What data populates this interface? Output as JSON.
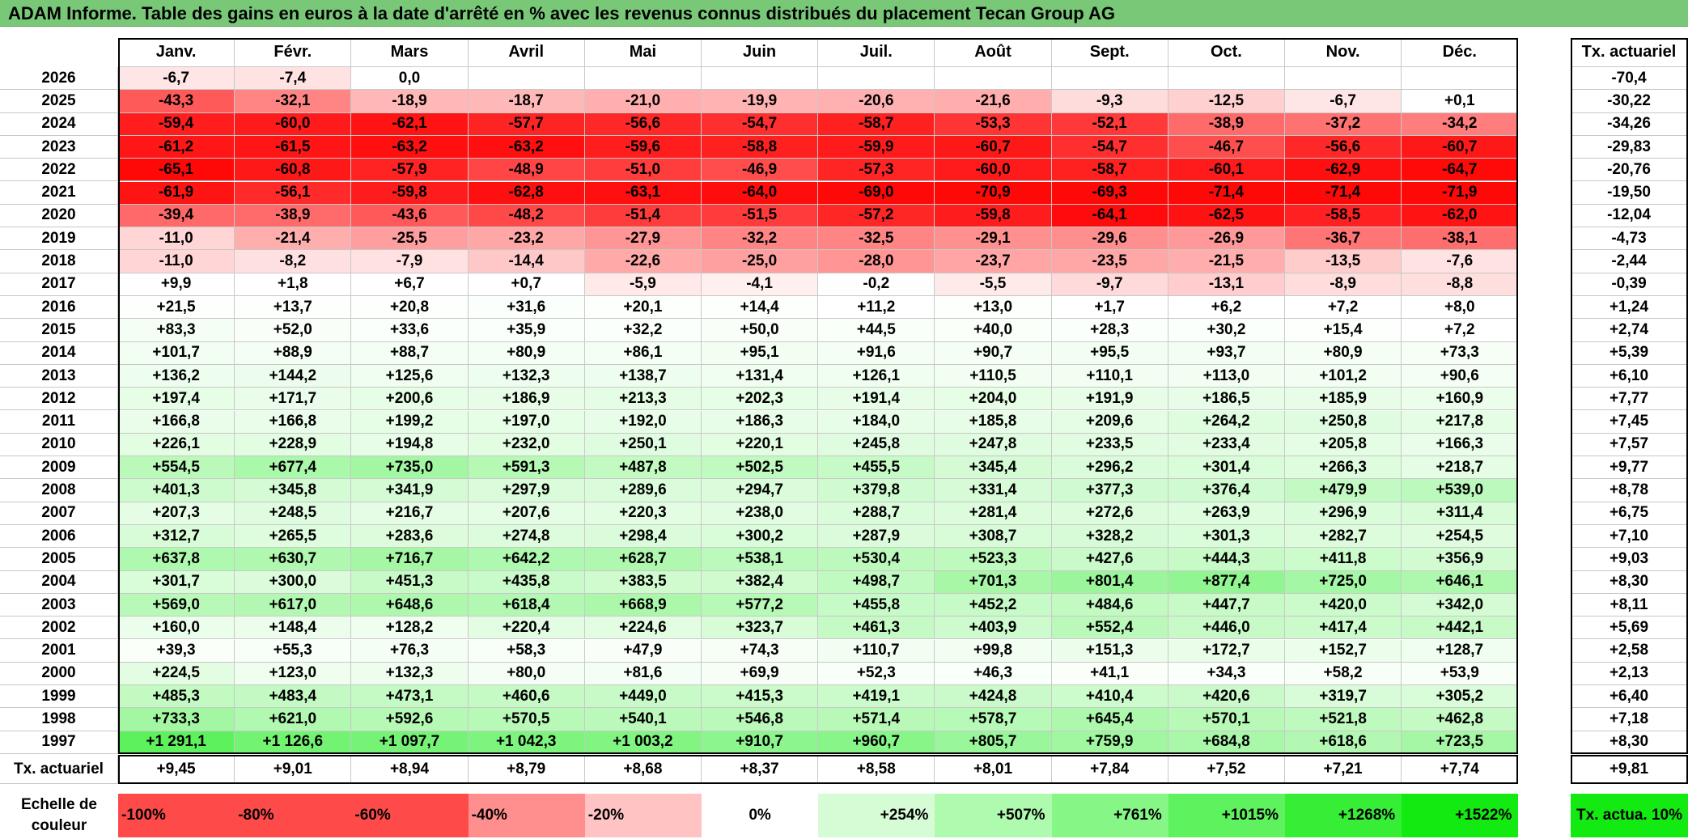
{
  "title": "ADAM Informe. Table des gains en euros à la date d'arrêté en % avec les revenus connus distribués du placement Tecan Group AG",
  "headers": {
    "months": [
      "Janv.",
      "Févr.",
      "Mars",
      "Avril",
      "Mai",
      "Juin",
      "Juil.",
      "Août",
      "Sept.",
      "Oct.",
      "Nov.",
      "Déc."
    ],
    "rate": "Tx. actuariel"
  },
  "chart_data": {
    "type": "table",
    "title": "ADAM Informe. Table des gains en euros à la date d'arrêté en % avec les revenus connus distribués du placement Tecan Group AG",
    "columns": [
      "Janv.",
      "Févr.",
      "Mars",
      "Avril",
      "Mai",
      "Juin",
      "Juil.",
      "Août",
      "Sept.",
      "Oct.",
      "Nov.",
      "Déc.",
      "Tx. actuariel"
    ],
    "rows": [
      {
        "year": "2026",
        "values": [
          "-6,7",
          "-7,4",
          "0,0",
          "",
          "",
          "",
          "",
          "",
          "",
          "",
          "",
          ""
        ],
        "rate": "-70,4"
      },
      {
        "year": "2025",
        "values": [
          "-43,3",
          "-32,1",
          "-18,9",
          "-18,7",
          "-21,0",
          "-19,9",
          "-20,6",
          "-21,6",
          "-9,3",
          "-12,5",
          "-6,7",
          "+0,1"
        ],
        "rate": "-30,22"
      },
      {
        "year": "2024",
        "values": [
          "-59,4",
          "-60,0",
          "-62,1",
          "-57,7",
          "-56,6",
          "-54,7",
          "-58,7",
          "-53,3",
          "-52,1",
          "-38,9",
          "-37,2",
          "-34,2"
        ],
        "rate": "-34,26"
      },
      {
        "year": "2023",
        "values": [
          "-61,2",
          "-61,5",
          "-63,2",
          "-63,2",
          "-59,6",
          "-58,8",
          "-59,9",
          "-60,7",
          "-54,7",
          "-46,7",
          "-56,6",
          "-60,7"
        ],
        "rate": "-29,83"
      },
      {
        "year": "2022",
        "values": [
          "-65,1",
          "-60,8",
          "-57,9",
          "-48,9",
          "-51,0",
          "-46,9",
          "-57,3",
          "-60,0",
          "-58,7",
          "-60,1",
          "-62,9",
          "-64,7"
        ],
        "rate": "-20,76"
      },
      {
        "year": "2021",
        "values": [
          "-61,9",
          "-56,1",
          "-59,8",
          "-62,8",
          "-63,1",
          "-64,0",
          "-69,0",
          "-70,9",
          "-69,3",
          "-71,4",
          "-71,4",
          "-71,9"
        ],
        "rate": "-19,50"
      },
      {
        "year": "2020",
        "values": [
          "-39,4",
          "-38,9",
          "-43,6",
          "-48,2",
          "-51,4",
          "-51,5",
          "-57,2",
          "-59,8",
          "-64,1",
          "-62,5",
          "-58,5",
          "-62,0"
        ],
        "rate": "-12,04"
      },
      {
        "year": "2019",
        "values": [
          "-11,0",
          "-21,4",
          "-25,5",
          "-23,2",
          "-27,9",
          "-32,2",
          "-32,5",
          "-29,1",
          "-29,6",
          "-26,9",
          "-36,7",
          "-38,1"
        ],
        "rate": "-4,73"
      },
      {
        "year": "2018",
        "values": [
          "-11,0",
          "-8,2",
          "-7,9",
          "-14,4",
          "-22,6",
          "-25,0",
          "-28,0",
          "-23,7",
          "-23,5",
          "-21,5",
          "-13,5",
          "-7,6"
        ],
        "rate": "-2,44"
      },
      {
        "year": "2017",
        "values": [
          "+9,9",
          "+1,8",
          "+6,7",
          "+0,7",
          "-5,9",
          "-4,1",
          "-0,2",
          "-5,5",
          "-9,7",
          "-13,1",
          "-8,9",
          "-8,8"
        ],
        "rate": "-0,39"
      },
      {
        "year": "2016",
        "values": [
          "+21,5",
          "+13,7",
          "+20,8",
          "+31,6",
          "+20,1",
          "+14,4",
          "+11,2",
          "+13,0",
          "+1,7",
          "+6,2",
          "+7,2",
          "+8,0"
        ],
        "rate": "+1,24"
      },
      {
        "year": "2015",
        "values": [
          "+83,3",
          "+52,0",
          "+33,6",
          "+35,9",
          "+32,2",
          "+50,0",
          "+44,5",
          "+40,0",
          "+28,3",
          "+30,2",
          "+15,4",
          "+7,2"
        ],
        "rate": "+2,74"
      },
      {
        "year": "2014",
        "values": [
          "+101,7",
          "+88,9",
          "+88,7",
          "+80,9",
          "+86,1",
          "+95,1",
          "+91,6",
          "+90,7",
          "+95,5",
          "+93,7",
          "+80,9",
          "+73,3"
        ],
        "rate": "+5,39"
      },
      {
        "year": "2013",
        "values": [
          "+136,2",
          "+144,2",
          "+125,6",
          "+132,3",
          "+138,7",
          "+131,4",
          "+126,1",
          "+110,5",
          "+110,1",
          "+113,0",
          "+101,2",
          "+90,6"
        ],
        "rate": "+6,10"
      },
      {
        "year": "2012",
        "values": [
          "+197,4",
          "+171,7",
          "+200,6",
          "+186,9",
          "+213,3",
          "+202,3",
          "+191,4",
          "+204,0",
          "+191,9",
          "+186,5",
          "+185,9",
          "+160,9"
        ],
        "rate": "+7,77"
      },
      {
        "year": "2011",
        "values": [
          "+166,8",
          "+166,8",
          "+199,2",
          "+197,0",
          "+192,0",
          "+186,3",
          "+184,0",
          "+185,8",
          "+209,6",
          "+264,2",
          "+250,8",
          "+217,8"
        ],
        "rate": "+7,45"
      },
      {
        "year": "2010",
        "values": [
          "+226,1",
          "+228,9",
          "+194,8",
          "+232,0",
          "+250,1",
          "+220,1",
          "+245,8",
          "+247,8",
          "+233,5",
          "+233,4",
          "+205,8",
          "+166,3"
        ],
        "rate": "+7,57"
      },
      {
        "year": "2009",
        "values": [
          "+554,5",
          "+677,4",
          "+735,0",
          "+591,3",
          "+487,8",
          "+502,5",
          "+455,5",
          "+345,4",
          "+296,2",
          "+301,4",
          "+266,3",
          "+218,7"
        ],
        "rate": "+9,77"
      },
      {
        "year": "2008",
        "values": [
          "+401,3",
          "+345,8",
          "+341,9",
          "+297,9",
          "+289,6",
          "+294,7",
          "+379,8",
          "+331,4",
          "+377,3",
          "+376,4",
          "+479,9",
          "+539,0"
        ],
        "rate": "+8,78"
      },
      {
        "year": "2007",
        "values": [
          "+207,3",
          "+248,5",
          "+216,7",
          "+207,6",
          "+220,3",
          "+238,0",
          "+288,7",
          "+281,4",
          "+272,6",
          "+263,9",
          "+296,9",
          "+311,4"
        ],
        "rate": "+6,75"
      },
      {
        "year": "2006",
        "values": [
          "+312,7",
          "+265,5",
          "+283,6",
          "+274,8",
          "+298,4",
          "+300,2",
          "+287,9",
          "+308,7",
          "+328,2",
          "+301,3",
          "+282,7",
          "+254,5"
        ],
        "rate": "+7,10"
      },
      {
        "year": "2005",
        "values": [
          "+637,8",
          "+630,7",
          "+716,7",
          "+642,2",
          "+628,7",
          "+538,1",
          "+530,4",
          "+523,3",
          "+427,6",
          "+444,3",
          "+411,8",
          "+356,9"
        ],
        "rate": "+9,03"
      },
      {
        "year": "2004",
        "values": [
          "+301,7",
          "+300,0",
          "+451,3",
          "+435,8",
          "+383,5",
          "+382,4",
          "+498,7",
          "+701,3",
          "+801,4",
          "+877,4",
          "+725,0",
          "+646,1"
        ],
        "rate": "+8,30"
      },
      {
        "year": "2003",
        "values": [
          "+569,0",
          "+617,0",
          "+648,6",
          "+618,4",
          "+668,9",
          "+577,2",
          "+455,8",
          "+452,2",
          "+484,6",
          "+447,7",
          "+420,0",
          "+342,0"
        ],
        "rate": "+8,11"
      },
      {
        "year": "2002",
        "values": [
          "+160,0",
          "+148,4",
          "+128,2",
          "+220,4",
          "+224,6",
          "+323,7",
          "+461,3",
          "+403,9",
          "+552,4",
          "+446,0",
          "+417,4",
          "+442,1"
        ],
        "rate": "+5,69"
      },
      {
        "year": "2001",
        "values": [
          "+39,3",
          "+55,3",
          "+76,3",
          "+58,3",
          "+47,9",
          "+74,3",
          "+110,7",
          "+99,8",
          "+151,3",
          "+172,7",
          "+152,7",
          "+128,7"
        ],
        "rate": "+2,58"
      },
      {
        "year": "2000",
        "values": [
          "+224,5",
          "+123,0",
          "+132,3",
          "+80,0",
          "+81,6",
          "+69,9",
          "+52,3",
          "+46,3",
          "+41,1",
          "+34,3",
          "+58,2",
          "+53,9"
        ],
        "rate": "+2,13"
      },
      {
        "year": "1999",
        "values": [
          "+485,3",
          "+483,4",
          "+473,1",
          "+460,6",
          "+449,0",
          "+415,3",
          "+419,1",
          "+424,8",
          "+410,4",
          "+420,6",
          "+319,7",
          "+305,2"
        ],
        "rate": "+6,40"
      },
      {
        "year": "1998",
        "values": [
          "+733,3",
          "+621,0",
          "+592,6",
          "+570,5",
          "+540,1",
          "+546,8",
          "+571,4",
          "+578,7",
          "+645,4",
          "+570,1",
          "+521,8",
          "+462,8"
        ],
        "rate": "+7,18"
      },
      {
        "year": "1997",
        "values": [
          "+1 291,1",
          "+1 126,6",
          "+1 097,7",
          "+1 042,3",
          "+1 003,2",
          "+910,7",
          "+960,7",
          "+805,7",
          "+759,9",
          "+684,8",
          "+618,6",
          "+723,5"
        ],
        "rate": "+8,30"
      }
    ],
    "footer": {
      "label": "Tx. actuariel",
      "values": [
        "+9,45",
        "+9,01",
        "+8,94",
        "+8,79",
        "+8,68",
        "+8,37",
        "+8,58",
        "+8,01",
        "+7,84",
        "+7,52",
        "+7,21",
        "+7,74"
      ],
      "rate": "+9,81"
    }
  },
  "legend": {
    "title": "Echelle de couleur",
    "items": [
      {
        "label": "-100%",
        "color": "#ff4a4a"
      },
      {
        "label": "-80%",
        "color": "#ff4a4a"
      },
      {
        "label": "-60%",
        "color": "#ff4a4a"
      },
      {
        "label": "-40%",
        "color": "#ff8e8e"
      },
      {
        "label": "-20%",
        "color": "#ffc3c3"
      },
      {
        "label": "0%",
        "color": "#ffffff"
      },
      {
        "label": "+254%",
        "color": "#d6fcd6"
      },
      {
        "label": "+507%",
        "color": "#aefaae"
      },
      {
        "label": "+761%",
        "color": "#86f686"
      },
      {
        "label": "+1015%",
        "color": "#5ef25e"
      },
      {
        "label": "+1268%",
        "color": "#36ee36"
      },
      {
        "label": "+1522%",
        "color": "#12ea12"
      }
    ],
    "rate_label": "Tx. actua. 10%",
    "rate_color": "#12ea12"
  }
}
